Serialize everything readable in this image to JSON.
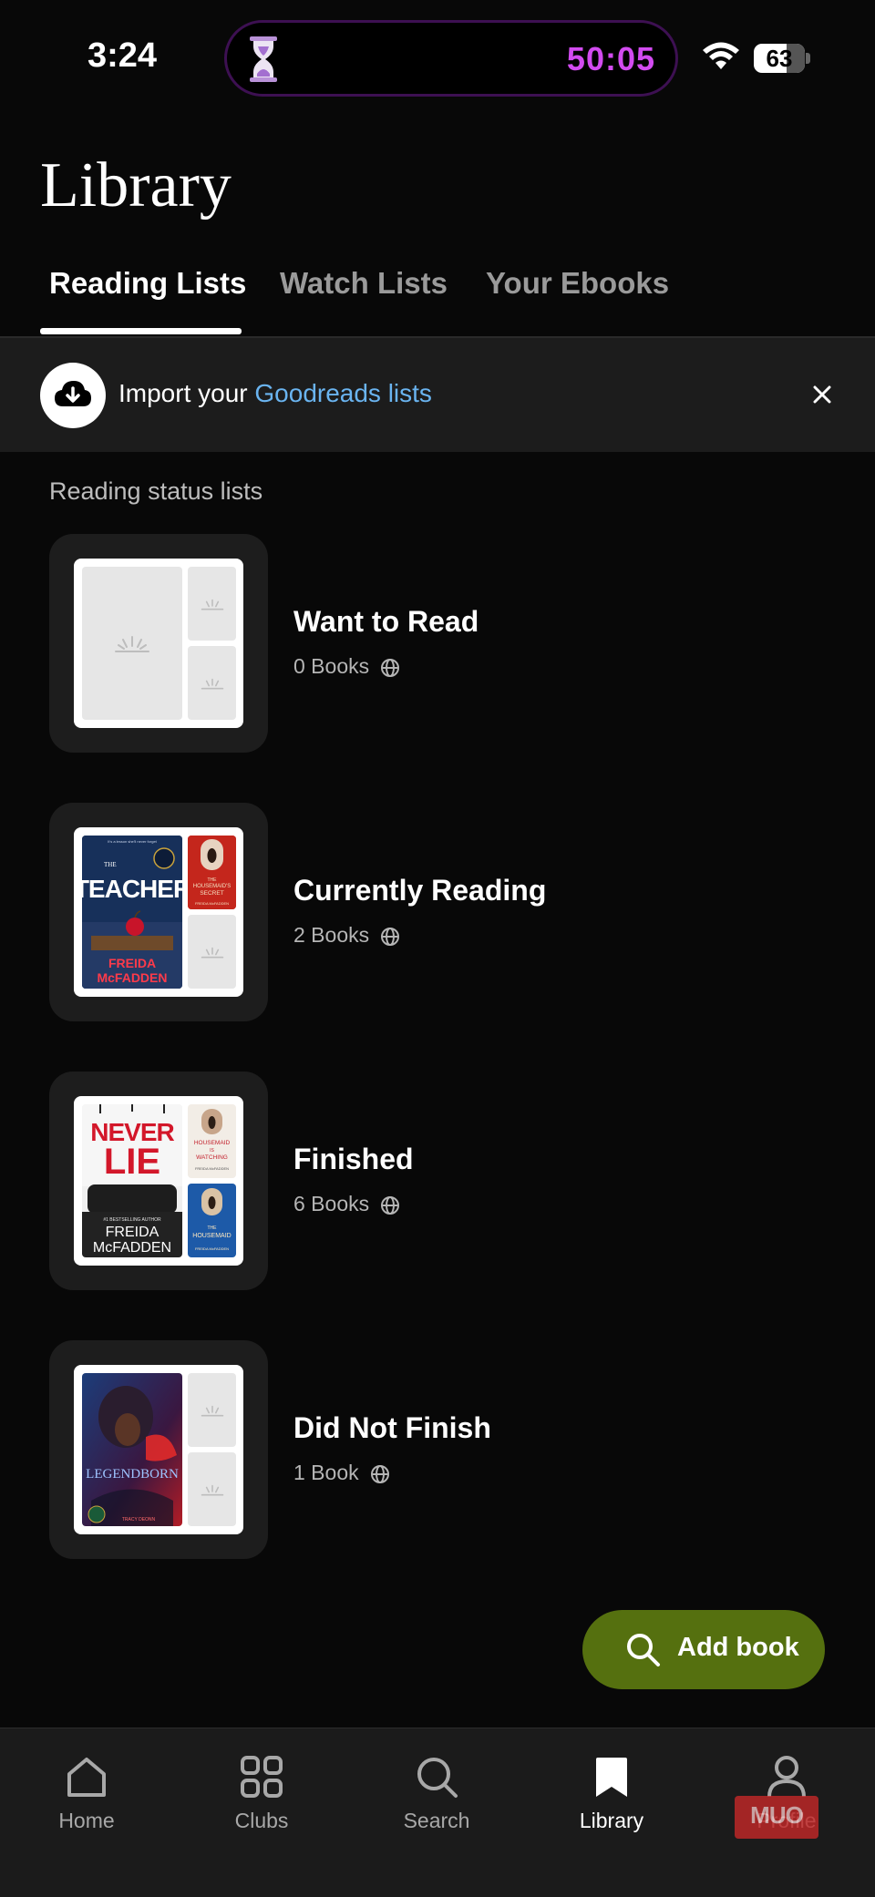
{
  "status_bar": {
    "time": "3:24",
    "timer": "50:05",
    "battery": "63",
    "timer_color": "#d24bf0"
  },
  "page": {
    "title": "Library"
  },
  "tabs": [
    {
      "label": "Reading Lists",
      "active": true
    },
    {
      "label": "Watch Lists",
      "active": false
    },
    {
      "label": "Your Ebooks",
      "active": false
    }
  ],
  "import_banner": {
    "prefix": "Import your ",
    "link": "Goodreads lists",
    "close_icon": "close-icon",
    "link_color": "#6ab4f0"
  },
  "section_label": "Reading status lists",
  "lists": [
    {
      "title": "Want to Read",
      "count": "0 Books",
      "visibility_icon": "globe-icon"
    },
    {
      "title": "Currently Reading",
      "count": "2 Books",
      "visibility_icon": "globe-icon",
      "covers": {
        "main": {
          "top": "It's a lesson she'll never forget",
          "title": "THE TEACHER",
          "author": "FREIDA McFADDEN"
        },
        "small": {
          "title": "THE HOUSEMAID'S SECRET",
          "author": "FREIDA McFADDEN"
        }
      }
    },
    {
      "title": "Finished",
      "count": "6 Books",
      "visibility_icon": "globe-icon",
      "covers": {
        "main": {
          "title": "NEVER LIE",
          "tagline": "#1 BESTSELLING AUTHOR",
          "author": "FREIDA McFADDEN"
        },
        "small1": {
          "title": "THE HOUSEMAID IS WATCHING",
          "author": "FREIDA McFADDEN"
        },
        "small2": {
          "title": "THE HOUSEMAID",
          "author": "FREIDA McFADDEN"
        }
      }
    },
    {
      "title": "Did Not Finish",
      "count": "1 Book",
      "visibility_icon": "globe-icon",
      "covers": {
        "main": {
          "title": "LEGENDBORN",
          "author": "TRACY DEONN"
        }
      }
    }
  ],
  "add_book": {
    "label": "Add book",
    "color": "#55700f"
  },
  "bottom_nav": [
    {
      "label": "Home",
      "icon": "home-icon",
      "active": false
    },
    {
      "label": "Clubs",
      "icon": "clubs-grid-icon",
      "active": false
    },
    {
      "label": "Search",
      "icon": "search-icon",
      "active": false
    },
    {
      "label": "Library",
      "icon": "bookmark-icon",
      "active": true
    },
    {
      "label": "Profile",
      "icon": "person-icon",
      "active": false
    }
  ],
  "watermark": "MUO"
}
